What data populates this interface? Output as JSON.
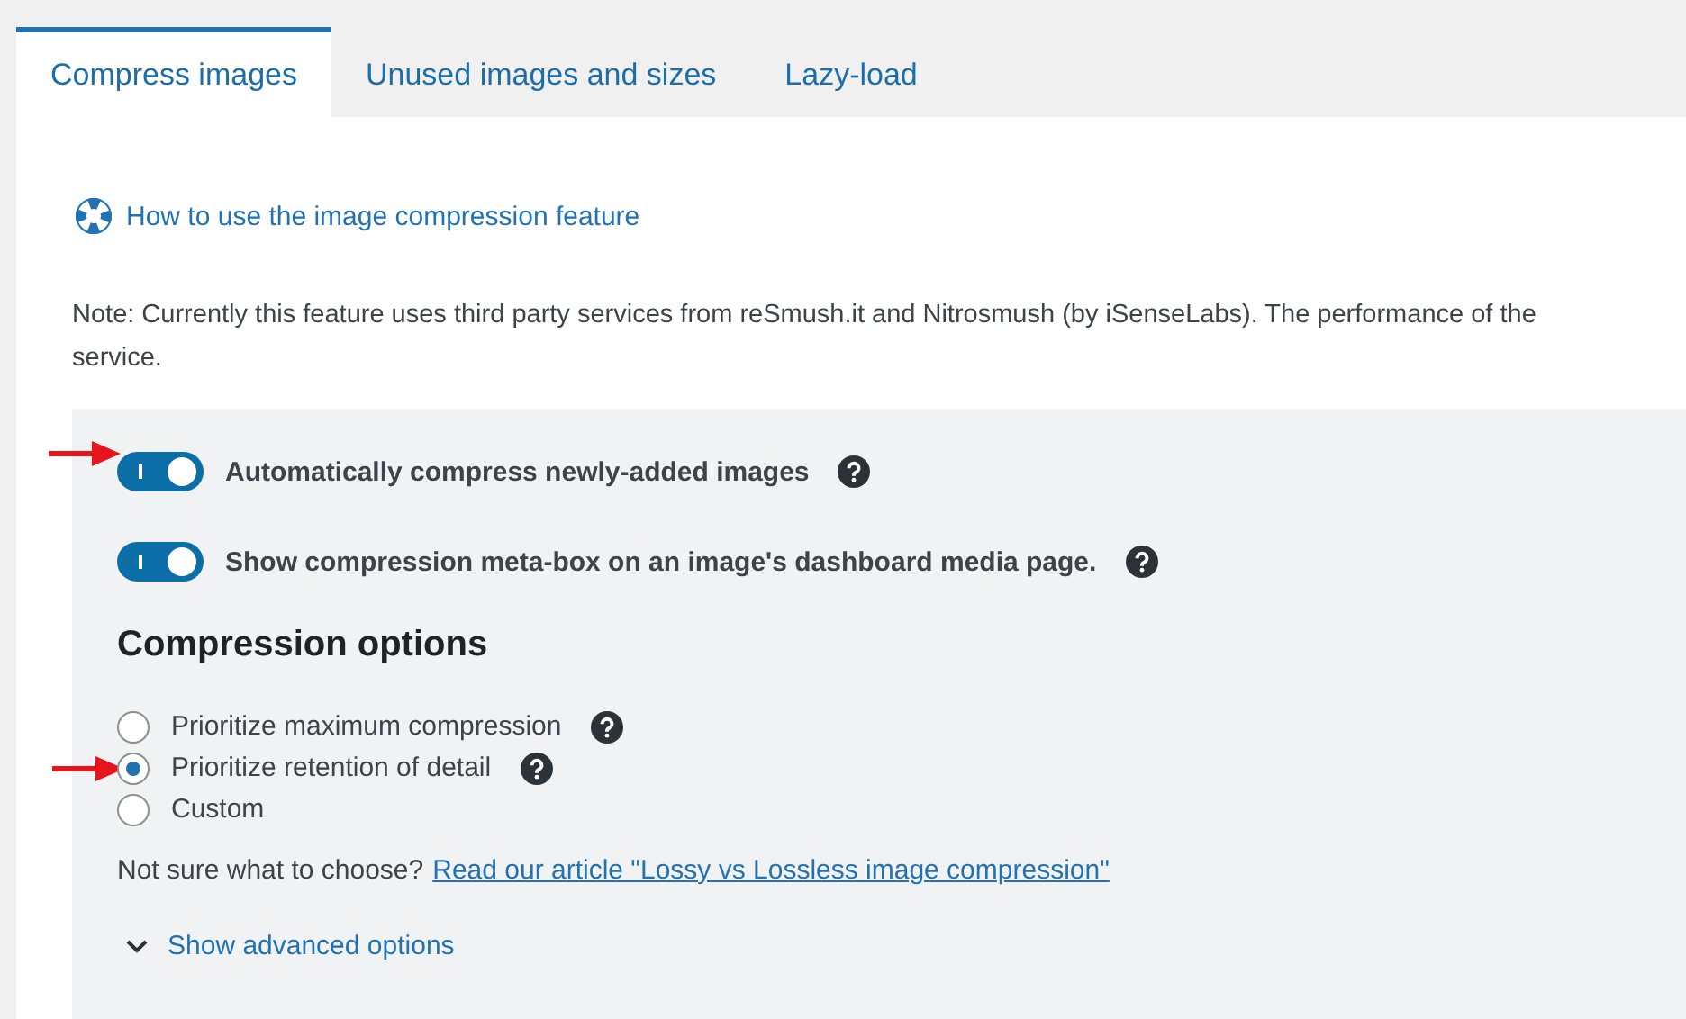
{
  "tabs": [
    {
      "label": "Compress images",
      "selected": true
    },
    {
      "label": "Unused images and sizes",
      "selected": false
    },
    {
      "label": "Lazy-load",
      "selected": false
    }
  ],
  "help_link": "How to use the image compression feature",
  "note_lines": [
    "Note: Currently this feature uses third party services from reSmush.it and Nitrosmush (by iSenseLabs). The performance of the",
    "service."
  ],
  "toggles": [
    {
      "label": "Automatically compress newly-added images",
      "on": true,
      "marked": true
    },
    {
      "label": "Show compression meta-box on an image's dashboard media page.",
      "on": true,
      "marked": false
    }
  ],
  "compression_options": {
    "heading": "Compression options",
    "options": [
      {
        "label": "Prioritize maximum compression",
        "selected": false,
        "help": true,
        "marked": false
      },
      {
        "label": "Prioritize retention of detail",
        "selected": true,
        "help": true,
        "marked": true
      },
      {
        "label": "Custom",
        "selected": false,
        "help": false,
        "marked": false
      }
    ],
    "hint": "Not sure what to choose?",
    "article_link": "Read our article \"Lossy vs Lossless image compression\""
  },
  "advanced_toggle": "Show advanced options"
}
